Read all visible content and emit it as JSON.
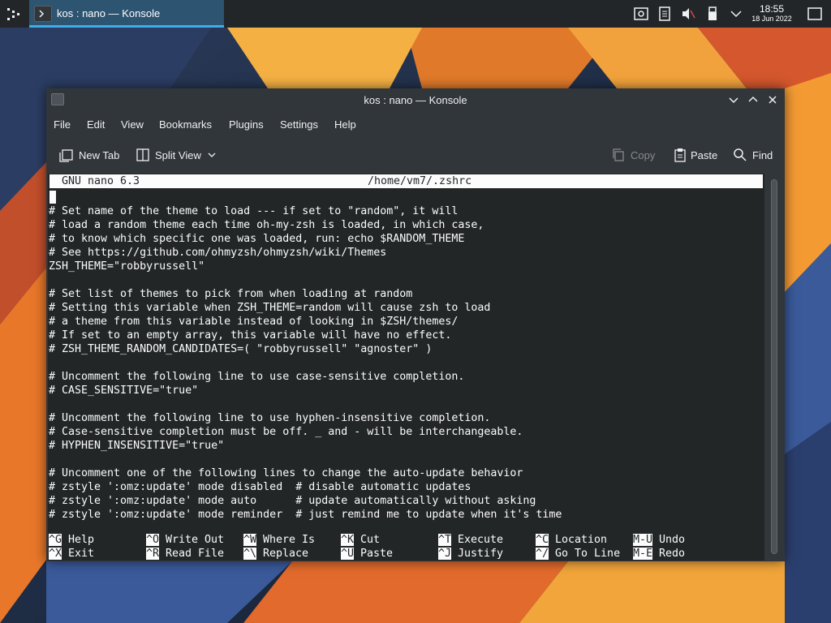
{
  "taskbar": {
    "task_label": "kos : nano — Konsole",
    "clock_time": "18:55",
    "clock_date": "18 Jun 2022"
  },
  "window": {
    "title": "kos : nano — Konsole",
    "menu": [
      "File",
      "Edit",
      "View",
      "Bookmarks",
      "Plugins",
      "Settings",
      "Help"
    ],
    "toolbar": {
      "new_tab": "New Tab",
      "split_view": "Split View",
      "copy": "Copy",
      "paste": "Paste",
      "find": "Find"
    }
  },
  "nano": {
    "version": "GNU nano 6.3",
    "filename": "/home/vm7/.zshrc",
    "lines": [
      "",
      "# Set name of the theme to load --- if set to \"random\", it will",
      "# load a random theme each time oh-my-zsh is loaded, in which case,",
      "# to know which specific one was loaded, run: echo $RANDOM_THEME",
      "# See https://github.com/ohmyzsh/ohmyzsh/wiki/Themes",
      "ZSH_THEME=\"robbyrussell\"",
      "",
      "# Set list of themes to pick from when loading at random",
      "# Setting this variable when ZSH_THEME=random will cause zsh to load",
      "# a theme from this variable instead of looking in $ZSH/themes/",
      "# If set to an empty array, this variable will have no effect.",
      "# ZSH_THEME_RANDOM_CANDIDATES=( \"robbyrussell\" \"agnoster\" )",
      "",
      "# Uncomment the following line to use case-sensitive completion.",
      "# CASE_SENSITIVE=\"true\"",
      "",
      "# Uncomment the following line to use hyphen-insensitive completion.",
      "# Case-sensitive completion must be off. _ and - will be interchangeable.",
      "# HYPHEN_INSENSITIVE=\"true\"",
      "",
      "# Uncomment one of the following lines to change the auto-update behavior",
      "# zstyle ':omz:update' mode disabled  # disable automatic updates",
      "# zstyle ':omz:update' mode auto      # update automatically without asking",
      "# zstyle ':omz:update' mode reminder  # just remind me to update when it's time"
    ],
    "shortcuts": [
      [
        {
          "key": "^G",
          "label": "Help"
        },
        {
          "key": "^X",
          "label": "Exit"
        }
      ],
      [
        {
          "key": "^O",
          "label": "Write Out"
        },
        {
          "key": "^R",
          "label": "Read File"
        }
      ],
      [
        {
          "key": "^W",
          "label": "Where Is"
        },
        {
          "key": "^\\",
          "label": "Replace"
        }
      ],
      [
        {
          "key": "^K",
          "label": "Cut"
        },
        {
          "key": "^U",
          "label": "Paste"
        }
      ],
      [
        {
          "key": "^T",
          "label": "Execute"
        },
        {
          "key": "^J",
          "label": "Justify"
        }
      ],
      [
        {
          "key": "^C",
          "label": "Location"
        },
        {
          "key": "^/",
          "label": "Go To Line"
        }
      ],
      [
        {
          "key": "M-U",
          "label": "Undo"
        },
        {
          "key": "M-E",
          "label": "Redo"
        }
      ]
    ]
  },
  "colors": {
    "accent": "#3daee9",
    "terminal_bg": "#232627",
    "terminal_fg": "#fcfcfc",
    "window_bg": "#31363b"
  }
}
